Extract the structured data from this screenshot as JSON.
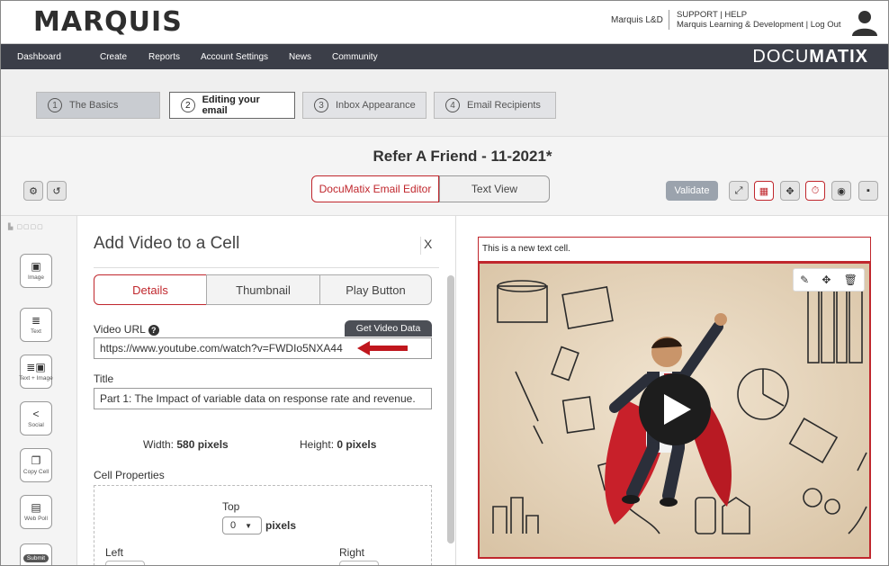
{
  "header": {
    "logo": "MARQUIS",
    "user_name": "Marquis L&D",
    "support_line": "SUPPORT | HELP",
    "org_line": "Marquis Learning & Development | Log Out",
    "brand_light": "DOCU",
    "brand_bold": "MATIX"
  },
  "nav": {
    "items": [
      "Dashboard",
      "Create",
      "Reports",
      "Account Settings",
      "News",
      "Community"
    ]
  },
  "steps": [
    {
      "num": "1",
      "label": "The Basics"
    },
    {
      "num": "2",
      "label": "Editing your email"
    },
    {
      "num": "3",
      "label": "Inbox Appearance"
    },
    {
      "num": "4",
      "label": "Email Recipients"
    }
  ],
  "document": {
    "title": "Refer A Friend - 11-2021*"
  },
  "view_tabs": {
    "editor": "DocuMatix Email Editor",
    "text": "Text View"
  },
  "toolbar": {
    "validate": "Validate"
  },
  "left_tools": [
    {
      "label": "Image",
      "icon": "image-icon",
      "glyph": "▣"
    },
    {
      "label": "Text",
      "icon": "text-icon",
      "glyph": "≣"
    },
    {
      "label": "Text + Image",
      "icon": "text-image-icon",
      "glyph": "≣▣"
    },
    {
      "label": "Social",
      "icon": "share-icon",
      "glyph": "<"
    },
    {
      "label": "Copy Cell",
      "icon": "copy-icon",
      "glyph": "❐"
    },
    {
      "label": "Web Poll",
      "icon": "poll-icon",
      "glyph": "▤"
    },
    {
      "label": "Submit",
      "icon": "submit-icon",
      "glyph": ""
    }
  ],
  "panel": {
    "title": "Add Video to a Cell",
    "close": "X",
    "tabs": [
      "Details",
      "Thumbnail",
      "Play Button"
    ],
    "video_url_label": "Video URL",
    "get_video_data": "Get Video Data",
    "video_url": "https://www.youtube.com/watch?v=FWDIo5NXA44",
    "title_label": "Title",
    "title_value": "Part 1: The Impact of variable data on response rate and revenue.",
    "width_label": "Width:",
    "width_value": "580 pixels",
    "height_label": "Height:",
    "height_value": "0 pixels",
    "cell_props_label": "Cell Properties",
    "top_label": "Top",
    "top_value": "0",
    "pixels_label": "pixels",
    "left_label": "Left",
    "right_label": "Right"
  },
  "preview": {
    "text_cell": "This is a new text cell."
  },
  "colors": {
    "accent": "#c0272d",
    "nav_bg": "#3b3e48",
    "step_bg": "#c9ccd1"
  }
}
